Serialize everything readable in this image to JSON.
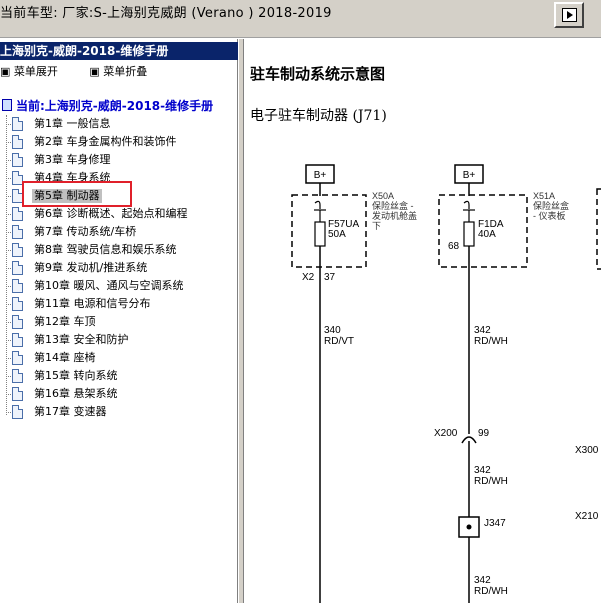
{
  "window": {
    "title": "当前车型:  厂家:S-上海别克威朗 (Verano ) 2018-2019"
  },
  "sidebar": {
    "book_title": "上海别克-威朗-2018-维修手册",
    "expand_label": "菜单展开",
    "collapse_label": "菜单折叠",
    "current_label": "当前:上海别克-威朗-2018-维修手册",
    "chapters": [
      "第1章 一般信息",
      "第2章 车身金属构件和装饰件",
      "第3章 车身修理",
      "第4章 车身系统",
      "第5章 制动器",
      "第6章 诊断概述、起始点和编程",
      "第7章 传动系统/车桥",
      "第8章 驾驶员信息和娱乐系统",
      "第9章 发动机/推进系统",
      "第10章 暖风、通风与空调系统",
      "第11章 电源和信号分布",
      "第12章 车顶",
      "第13章 安全和防护",
      "第14章 座椅",
      "第15章 转向系统",
      "第16章 悬架系统",
      "第17章 变速器"
    ],
    "selected_chapter": "第5章 制动器"
  },
  "content": {
    "heading": "驻车制动系统示意图",
    "subheading": "电子驻车制动器 (J71)",
    "diagram": {
      "left_power": "B+",
      "left_box_label": "X50A",
      "left_box_desc1": "保险丝盒 -",
      "left_box_desc2": "发动机舱盖",
      "left_box_desc3": "下",
      "left_fuse_name": "F57UA",
      "left_fuse_amp": "50A",
      "left_conn": "X2",
      "left_pin": "37",
      "left_wire_gauge": "340",
      "left_wire_color": "RD/VT",
      "right_power": "B+",
      "right_box_label": "X51A",
      "right_box_desc1": "保险丝盒",
      "right_box_desc2": "- 仪表板",
      "right_fuse_name": "F1DA",
      "right_fuse_amp": "40A",
      "right_pin_top": "68",
      "right_wire1_gauge": "342",
      "right_wire1_color": "RD/WH",
      "conn_x200": "X200",
      "conn_x200_pin": "99",
      "right_wire2_gauge": "342",
      "right_wire2_color": "RD/WH",
      "splice": "J347",
      "right_wire3_gauge": "342",
      "right_wire3_color": "RD/WH",
      "side_conn1": "X300",
      "side_conn2": "X210"
    }
  }
}
